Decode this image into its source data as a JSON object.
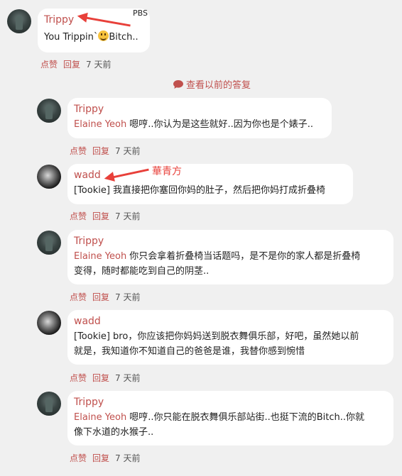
{
  "annotations": {
    "pbs": "PBS",
    "huaqingfang": "華青方"
  },
  "view_previous": "查看以前的答复",
  "comments": [
    {
      "author": "Trippy",
      "mention": "",
      "text_before": "You Trippin`",
      "emoji": "grinning-face",
      "text_after": "Bitch..",
      "like": "点赞",
      "reply": "回复",
      "time": "7 天前"
    },
    {
      "author": "Trippy",
      "mention": "Elaine Yeoh",
      "text": "嗯哼..你认为是这些就好..因为你也是个婊子..",
      "like": "点赞",
      "reply": "回复",
      "time": "7 天前"
    },
    {
      "author": "wadd",
      "mention": "",
      "text": "[Tookie] 我直接把你塞回你妈的肚子，然后把你妈打成折叠椅",
      "like": "点赞",
      "reply": "回复",
      "time": "7 天前"
    },
    {
      "author": "Trippy",
      "mention": "Elaine Yeoh",
      "text_line1": "你只会拿着折叠椅当话题吗，是不是你的家人都是折叠椅",
      "text_line2": "变得，随时都能吃到自己的阴茎..",
      "like": "点赞",
      "reply": "回复",
      "time": "7 天前"
    },
    {
      "author": "wadd",
      "mention": "",
      "text_line1": "[Tookie] bro，你应该把你妈妈送到脱衣舞俱乐部，好吧，虽然她以前",
      "text_line2": "就是，我知道你不知道自己的爸爸是谁，我替你感到惋惜",
      "like": "点赞",
      "reply": "回复",
      "time": "7 天前"
    },
    {
      "author": "Trippy",
      "mention": "Elaine Yeoh",
      "text_line1": "嗯哼..你只能在脱衣舞俱乐部站街..也挺下流的Bitch..你就",
      "text_line2": "像下水道的水猴子..",
      "like": "点赞",
      "reply": "回复",
      "time": "7 天前"
    }
  ]
}
